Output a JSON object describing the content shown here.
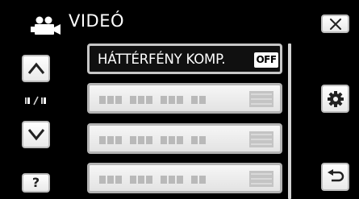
{
  "header": {
    "title": "VIDEÓ",
    "mode_icon": "video-camera-icon"
  },
  "toolbar": {
    "close_icon": "close-icon",
    "up_icon": "arrow-up-icon",
    "down_icon": "arrow-down-icon",
    "help_label": "?",
    "settings_icon": "gear-icon",
    "back_icon": "return-icon",
    "page_indicator_icon": "page-indicator-icon"
  },
  "menu": {
    "items": [
      {
        "label": "HÁTTÉRFÉNY KOMP.",
        "value": "OFF",
        "active": true
      },
      {
        "label": "",
        "value": "",
        "active": false
      },
      {
        "label": "",
        "value": "",
        "active": false
      },
      {
        "label": "",
        "value": "",
        "active": false
      }
    ]
  },
  "colors": {
    "background": "#000000",
    "button_face": "#f2f2f2",
    "button_border": "#bdbdbd",
    "icon": "#222222",
    "active_item": "#101010",
    "placeholder_glyph": "#b9b9b9"
  }
}
